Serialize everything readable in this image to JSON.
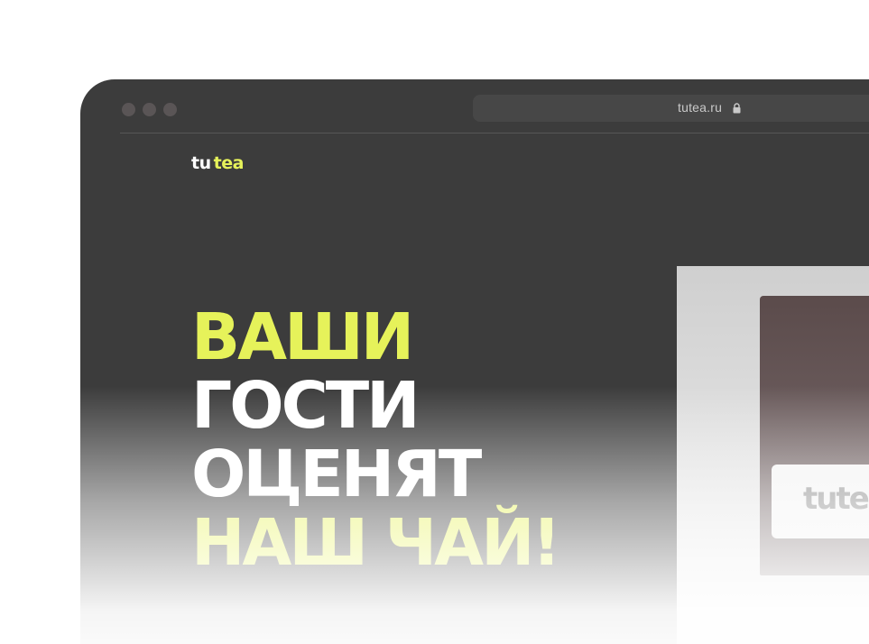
{
  "browser": {
    "address": "tutea.ru",
    "lock_icon": "lock-icon"
  },
  "site": {
    "logo_part1": "tu",
    "logo_part2": "tea",
    "headline": [
      "ВАШИ",
      "ГОСТИ",
      "ОЦЕНЯТ",
      "НАШ ЧАЙ!"
    ],
    "box_label": "tutea"
  },
  "colors": {
    "accent": "#e6f25a",
    "background": "#3c3c3c"
  }
}
